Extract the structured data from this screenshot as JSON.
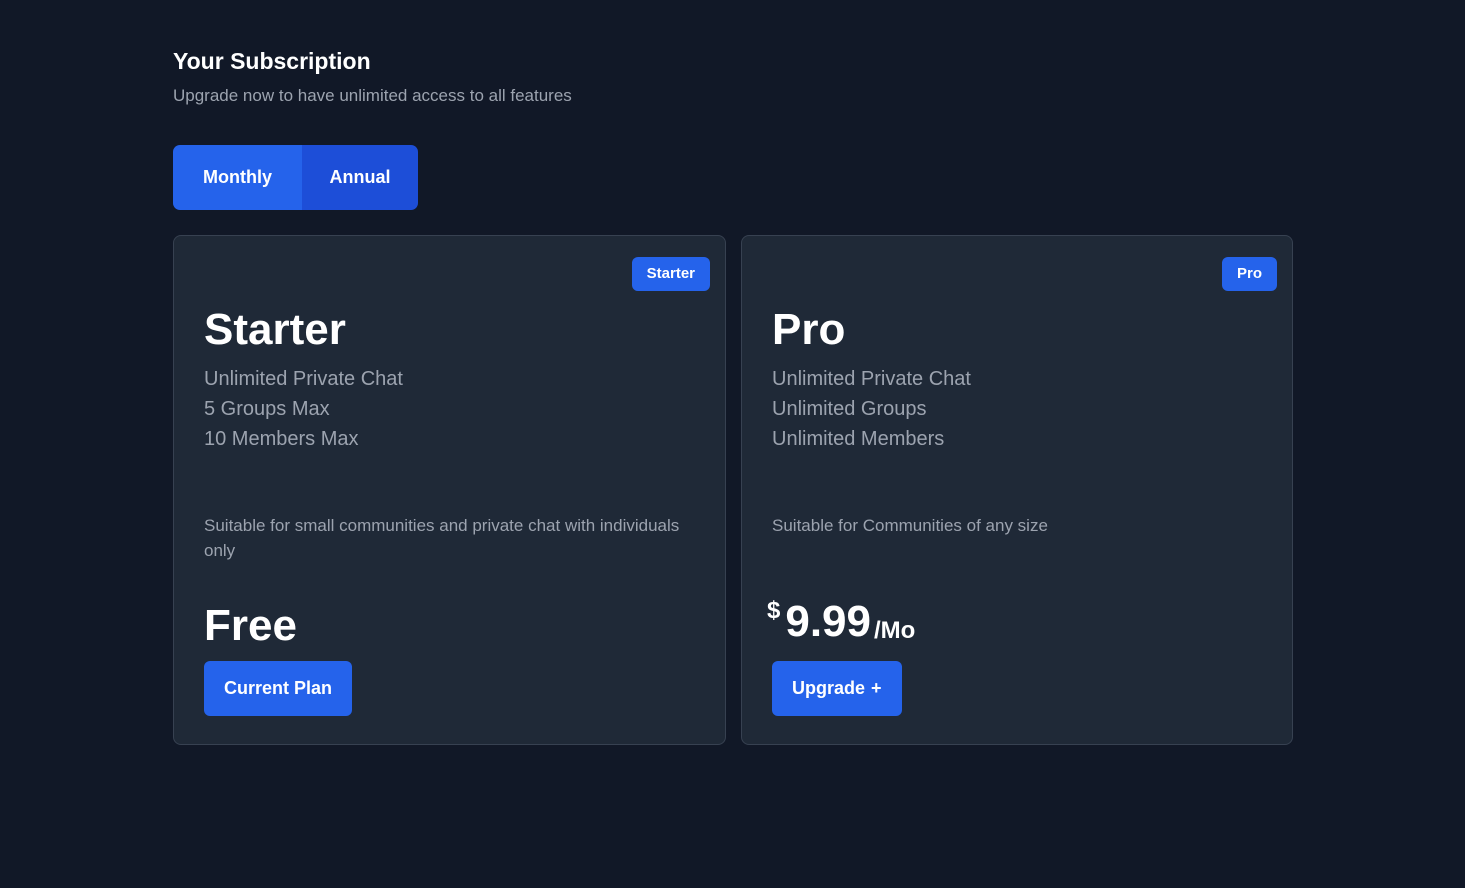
{
  "header": {
    "title": "Your Subscription",
    "subtitle": "Upgrade now to have unlimited access to all features"
  },
  "billing_toggle": {
    "monthly_label": "Monthly",
    "annual_label": "Annual",
    "selected": "Monthly"
  },
  "plans": [
    {
      "badge": "Starter",
      "name": "Starter",
      "features": [
        "Unlimited Private Chat",
        "5 Groups Max",
        "10 Members Max"
      ],
      "description": "Suitable for small communities and private chat with individuals only",
      "price_text": "Free",
      "button_label": "Current Plan"
    },
    {
      "badge": "Pro",
      "name": "Pro",
      "features": [
        "Unlimited Private Chat",
        "Unlimited Groups",
        "Unlimited Members"
      ],
      "description": "Suitable for Communities of any size",
      "price_currency": "$",
      "price_amount": "9.99",
      "price_period": "/Mo",
      "button_label": "Upgrade",
      "button_icon": "+"
    }
  ],
  "colors": {
    "background": "#111827",
    "card": "#1f2937",
    "accent": "#2563eb",
    "accent_dark": "#1d4ed8",
    "muted_text": "#9ca3af"
  }
}
